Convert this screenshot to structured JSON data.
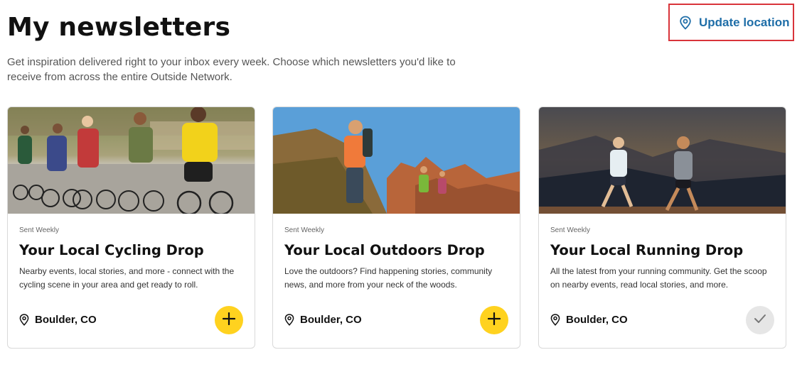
{
  "header": {
    "title": "My newsletters",
    "intro": "Get inspiration delivered right to your inbox every week. Choose which newsletters you'd like to receive from across the entire Outside Network.",
    "update_location": "Update location",
    "update_location_icon": "location-pin-icon",
    "accent_color": "#1f6ea8",
    "highlight_border_color": "#d9343a"
  },
  "cards": [
    {
      "frequency": "Sent Weekly",
      "title": "Your Local Cycling Drop",
      "description": "Nearby events, local stories, and more - connect with the cycling scene in your area and get ready to roll.",
      "location": "Boulder, CO",
      "location_icon": "location-pin-icon",
      "action_icon": "plus-icon",
      "subscribed": false,
      "image": "group of road cyclists riding"
    },
    {
      "frequency": "Sent Weekly",
      "title": "Your Local Outdoors Drop",
      "description": "Love the outdoors? Find happening stories, community news, and more from your neck of the woods.",
      "location": "Boulder, CO",
      "location_icon": "location-pin-icon",
      "action_icon": "plus-icon",
      "subscribed": false,
      "image": "hikers in red rock canyon"
    },
    {
      "frequency": "Sent Weekly",
      "title": "Your Local Running Drop",
      "description": "All the latest from your running community. Get the scoop on nearby events, read local stories, and more.",
      "location": "Boulder, CO",
      "location_icon": "location-pin-icon",
      "action_icon": "check-icon",
      "subscribed": true,
      "image": "two trail runners at dusk"
    }
  ],
  "colors": {
    "add_button": "#ffd21f",
    "subscribed_button": "#e6e6e6"
  }
}
